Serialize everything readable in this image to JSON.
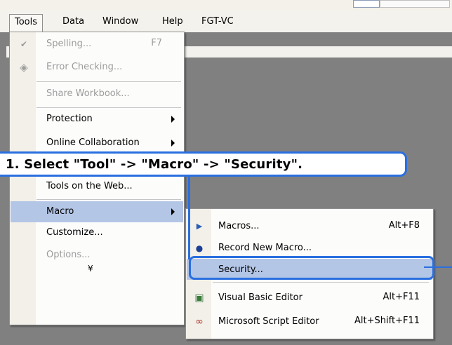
{
  "menubar": {
    "items": [
      "Tools",
      "Data",
      "Window",
      "Help",
      "FGT-VC"
    ]
  },
  "tools_menu": {
    "spelling": {
      "label": "Spelling...",
      "shortcut": "F7"
    },
    "error_checking": "Error Checking...",
    "share_workbook": "Share Workbook...",
    "protection": "Protection",
    "online_collaboration": "Online Collaboration",
    "tools_on_web": "Tools on the Web...",
    "macro": "Macro",
    "customize": "Customize...",
    "options": "Options..."
  },
  "macro_menu": {
    "macros": {
      "label": "Macros...",
      "shortcut": "Alt+F8"
    },
    "record": "Record New Macro...",
    "security": "Security...",
    "vbe": {
      "label": "Visual Basic Editor",
      "shortcut": "Alt+F11"
    },
    "script_editor": {
      "label": "Microsoft Script Editor",
      "shortcut": "Alt+Shift+F11"
    }
  },
  "annotation": {
    "text": "1. Select \"Tool\" -> \"Macro\" -> \"Security\"."
  },
  "colors": {
    "highlight": "#b4c6e6",
    "annotation_blue": "#2a6fe0"
  }
}
